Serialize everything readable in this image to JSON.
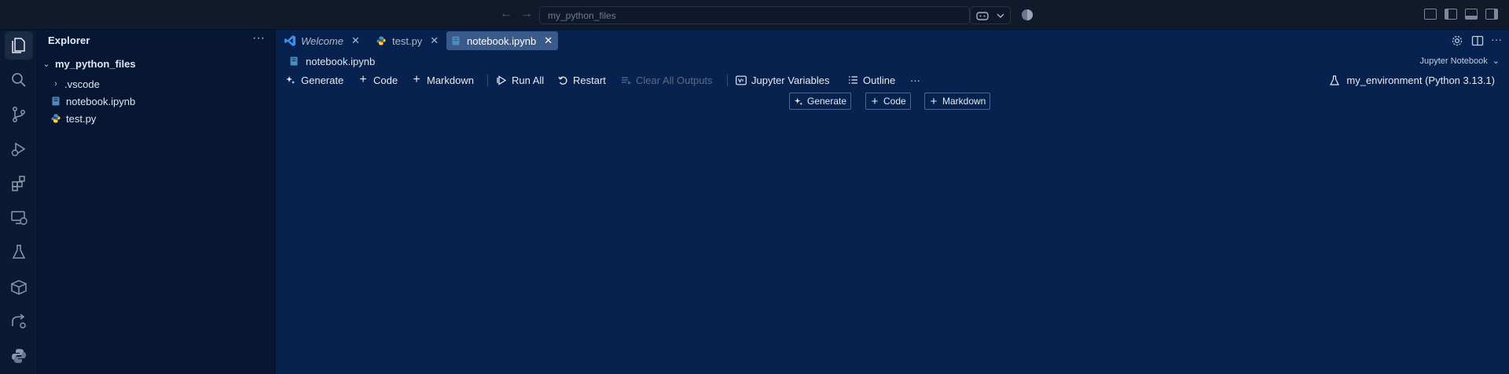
{
  "titlebar": {
    "search_text": "my_python_files",
    "back_icon": "arrow-left-icon",
    "forward_icon": "arrow-right-icon"
  },
  "activity_bar": {
    "items": [
      "explorer-icon",
      "search-icon",
      "source-control-icon",
      "run-debug-icon",
      "extensions-icon",
      "remote-explorer-icon",
      "testing-icon",
      "containers-icon",
      "live-share-icon",
      "python-icon"
    ]
  },
  "sidebar": {
    "title": "Explorer",
    "root_folder": "my_python_files",
    "items": [
      {
        "label": ".vscode",
        "type": "folder"
      },
      {
        "label": "notebook.ipynb",
        "type": "notebook"
      },
      {
        "label": "test.py",
        "type": "python"
      }
    ]
  },
  "tabs": [
    {
      "label": "Welcome",
      "icon": "vscode-icon",
      "active": false
    },
    {
      "label": "test.py",
      "icon": "python-file-icon",
      "active": false
    },
    {
      "label": "notebook.ipynb",
      "icon": "notebook-file-icon",
      "active": true
    }
  ],
  "breadcrumb": {
    "file": "notebook.ipynb",
    "kernel_type": "Jupyter Notebook"
  },
  "toolbar": {
    "generate": "Generate",
    "code": "Code",
    "markdown": "Markdown",
    "run_all": "Run All",
    "restart": "Restart",
    "clear_outputs": "Clear All Outputs",
    "variables": "Jupyter Variables",
    "outline": "Outline",
    "more": "···",
    "kernel": "my_environment (Python 3.13.1)"
  },
  "cell_buttons": {
    "generate": "Generate",
    "code": "Code",
    "markdown": "Markdown"
  },
  "colors": {
    "editor_bg": "#07224f",
    "sidebar_bg": "#061633",
    "titlebar_bg": "#111a2a",
    "active_tab": "#3a5a8c",
    "vscode_blue": "#3b8eea",
    "python_blue": "#4b8bbe",
    "python_yellow": "#ffd43b"
  }
}
